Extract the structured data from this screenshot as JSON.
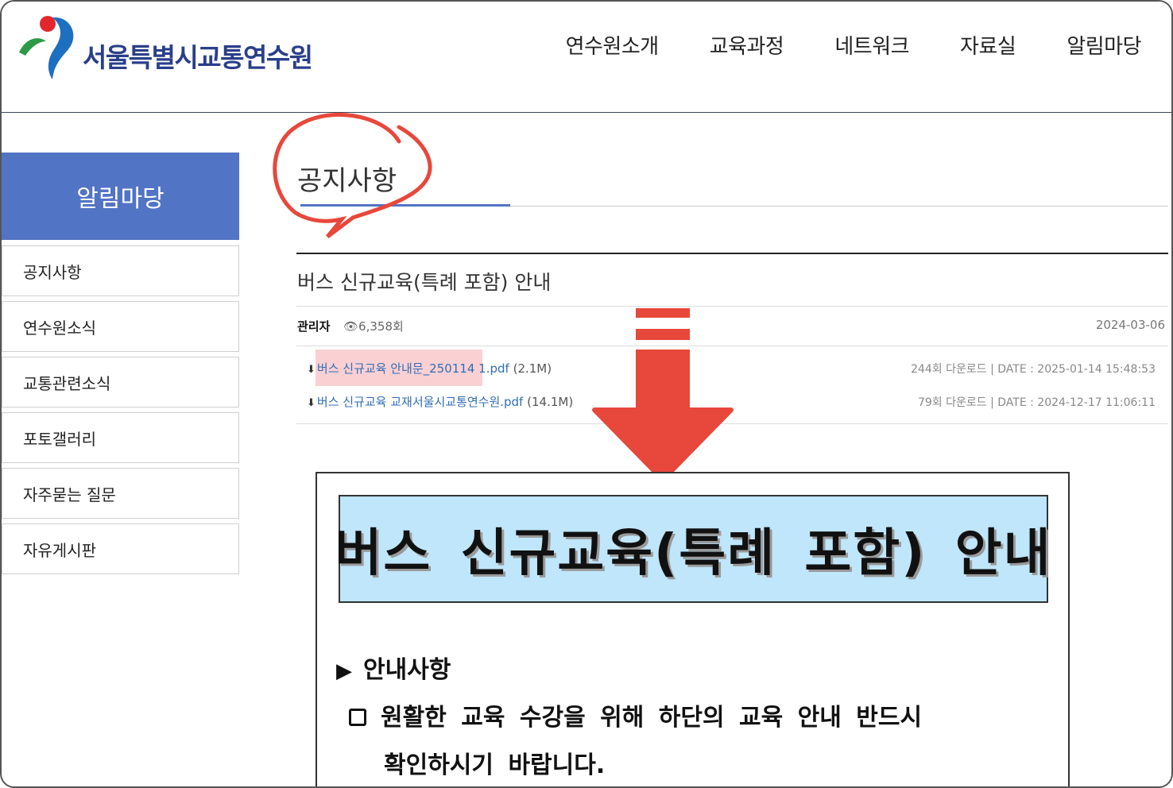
{
  "header": {
    "logo_text": "서울특별시교통연수원",
    "nav": [
      "연수원소개",
      "교육과정",
      "네트워크",
      "자료실",
      "알림마당"
    ]
  },
  "sidebar": {
    "title": "알림마당",
    "items": [
      "공지사항",
      "연수원소식",
      "교통관련소식",
      "포토갤러리",
      "자주묻는 질문",
      "자유게시판"
    ]
  },
  "page": {
    "title": "공지사항"
  },
  "post": {
    "title": "버스 신규교육(특례 포함) 안내",
    "author": "관리자",
    "views": "6,358회",
    "date": "2024-03-06",
    "files": [
      {
        "name": "버스 신규교육 안내문_250114 1.pdf",
        "size": "(2.1M)",
        "meta": "244회 다운로드 | DATE : 2025-01-14 15:48:53"
      },
      {
        "name": "버스 신규교육 교재서울시교통연수원.pdf",
        "size": "(14.1M)",
        "meta": "79회 다운로드 | DATE : 2024-12-17 11:06:11"
      }
    ]
  },
  "document": {
    "banner": "버스 신규교육(특례 포함) 안내",
    "heading": "안내사항",
    "line1": "원활한 교육 수강을 위해 하단의 교육 안내 반드시",
    "line2": "확인하시기 바랍니다."
  },
  "colors": {
    "brand_blue": "#5274c5",
    "link_blue": "#2f6eb5",
    "annotation_red": "#e8473b",
    "banner_bg": "#bfe6fb"
  }
}
